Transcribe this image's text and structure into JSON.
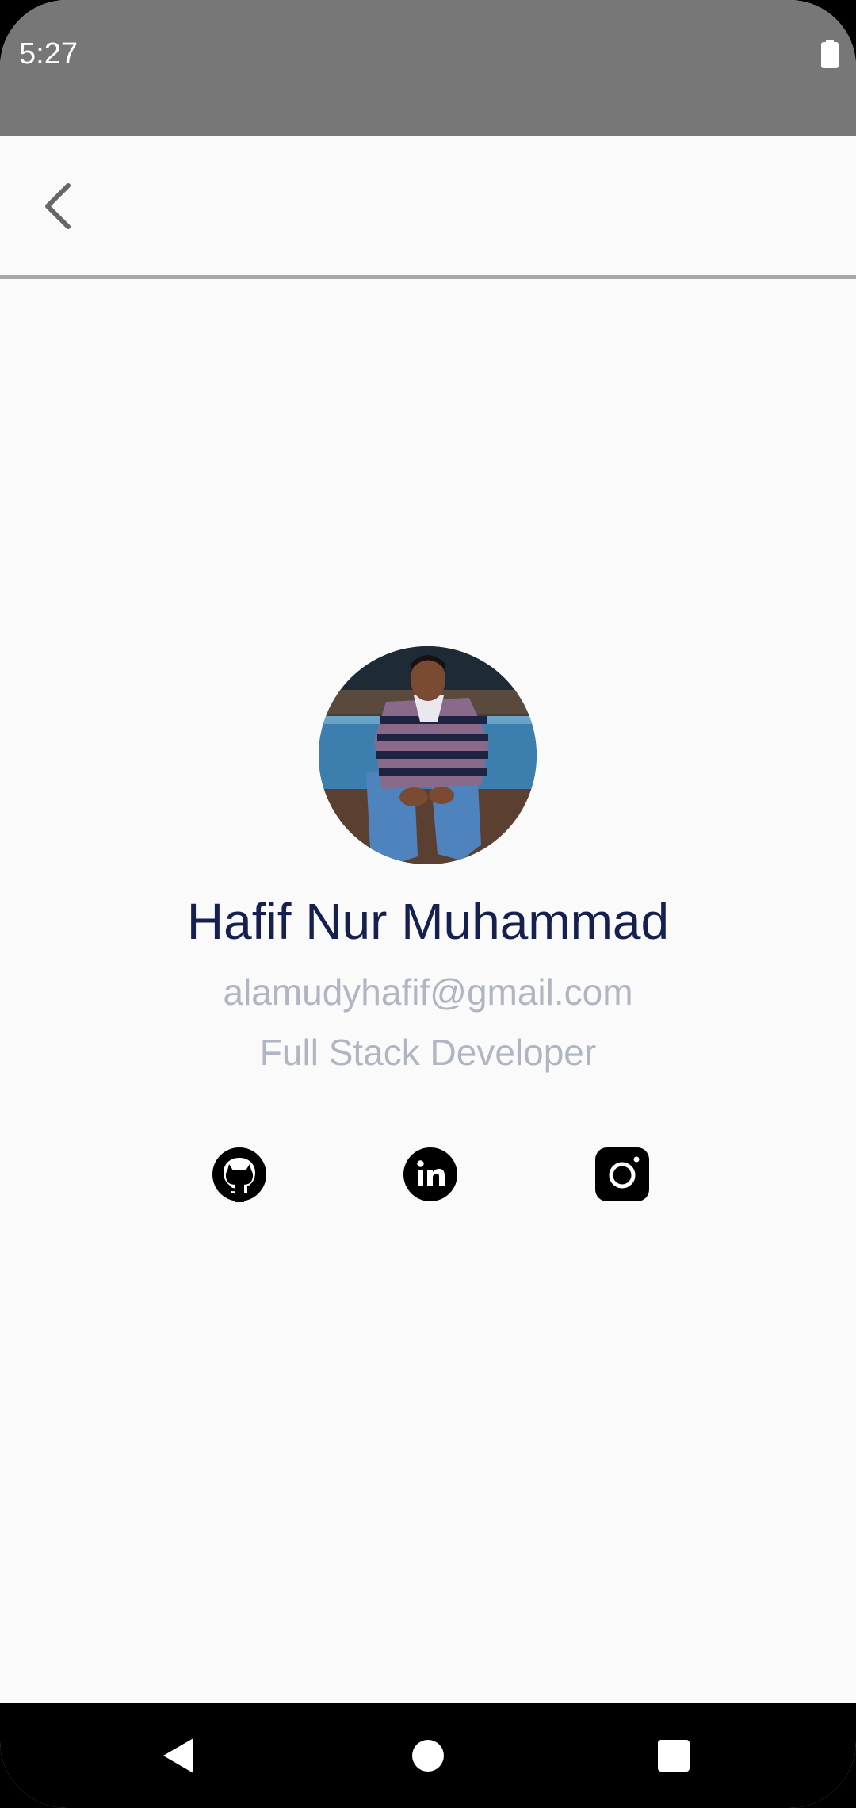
{
  "status_bar": {
    "time": "5:27",
    "icons": [
      "battery-icon"
    ]
  },
  "app_bar": {
    "back_icon": "chevron-left-icon"
  },
  "profile": {
    "name": "Hafif Nur Muhammad",
    "email": "alamudyhafif@gmail.com",
    "role": "Full Stack Developer",
    "avatar": "profile-photo"
  },
  "social_links": [
    {
      "icon": "github-icon"
    },
    {
      "icon": "linkedin-icon"
    },
    {
      "icon": "instagram-icon"
    }
  ],
  "nav_bar": {
    "icons": [
      "back-triangle-icon",
      "home-circle-icon",
      "recents-square-icon"
    ]
  },
  "colors": {
    "status_bar": "#777777",
    "background": "#fafafa",
    "divider": "#a9a9a9",
    "name_text": "#15204f",
    "secondary_text": "#b0b5c2",
    "nav_bar": "#000000"
  }
}
